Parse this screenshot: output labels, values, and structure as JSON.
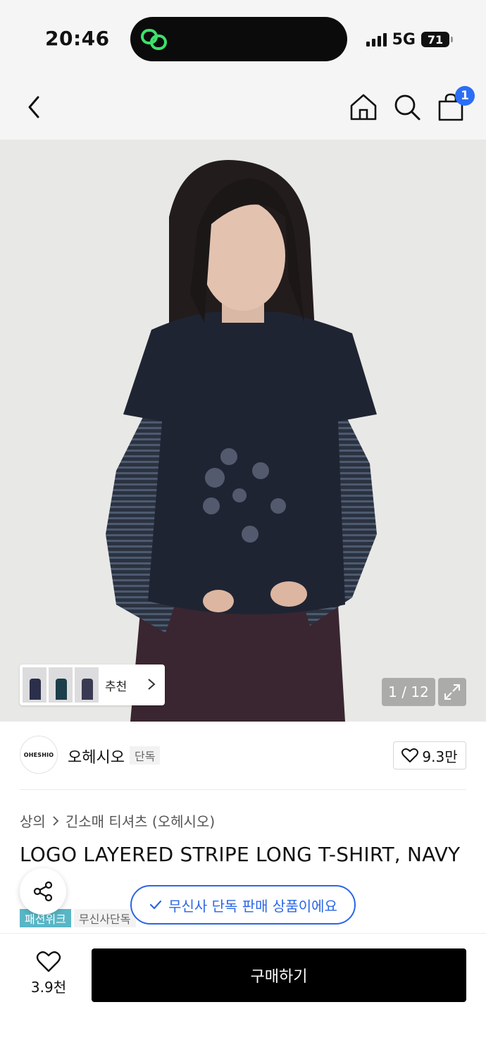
{
  "status_bar": {
    "time": "20:46",
    "network": "5G",
    "battery": "71"
  },
  "header": {
    "cart_count": "1"
  },
  "gallery": {
    "recommend_label": "추천",
    "counter": "1 / 12"
  },
  "brand": {
    "logo_text": "OHESHIO",
    "name": "오헤시오",
    "tag": "단독",
    "likes": "9.3만"
  },
  "breadcrumb": {
    "category": "상의",
    "subcategory": "긴소매 티셔츠 (오헤시오)"
  },
  "product": {
    "title": "LOGO LAYERED STRIPE LONG T-SHIRT, NAVY",
    "tags": [
      "패션위크",
      "무신사단독"
    ]
  },
  "toast": {
    "message": "무신사 단독 판매 상품이에요"
  },
  "bottom_bar": {
    "wish_count": "3.9천",
    "buy_label": "구매하기"
  },
  "colors": {
    "accent_blue": "#2a66e8",
    "badge_blue": "#2b6ef5",
    "tag_teal": "#58b6c6",
    "buy_black": "#000000"
  }
}
